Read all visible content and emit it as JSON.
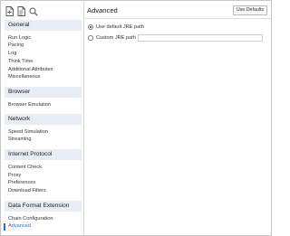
{
  "sidebar": {
    "toolbar_icons": [
      "new-file-icon",
      "import-file-icon",
      "search-icon"
    ],
    "sections": [
      {
        "title": "General",
        "items": [
          "Run Logic",
          "Pacing",
          "Log",
          "Think Time",
          "Additional Attributes",
          "Miscellaneous"
        ]
      },
      {
        "title": "Browser",
        "items": [
          "Browser Emulation"
        ]
      },
      {
        "title": "Network",
        "items": [
          "Speed Simulation",
          "Streaming"
        ]
      },
      {
        "title": "Internet Protocol",
        "items": [
          "Content Check",
          "Proxy",
          "Preferences",
          "Download Filters"
        ]
      },
      {
        "title": "Data Format Extension",
        "items": [
          "Chain Configuration",
          "Advanced"
        ]
      }
    ],
    "selected_item": "Advanced"
  },
  "content": {
    "title": "Advanced",
    "use_defaults_label": "Use Defaults",
    "options": [
      {
        "label": "Use default JRE path",
        "checked": true
      },
      {
        "label": "Custom JRE path",
        "checked": false
      }
    ],
    "custom_path_value": ""
  },
  "colors": {
    "section_header_bg": "#e8edf3",
    "accent": "#2a6fc0"
  }
}
